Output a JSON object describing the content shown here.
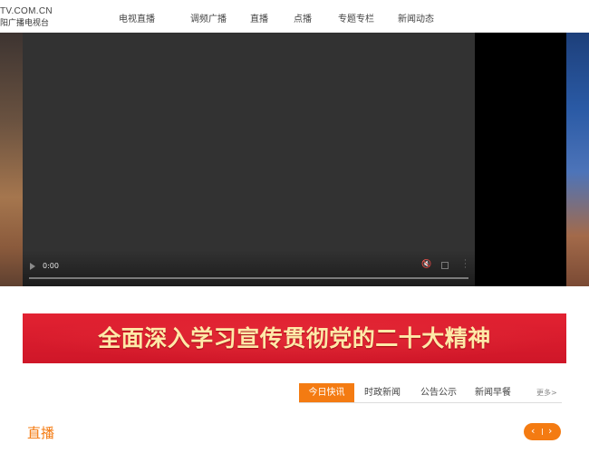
{
  "header": {
    "logo_top": "TV.COM.CN",
    "logo_bottom": "阳广播电视台",
    "nav": [
      "电视直播",
      "调频广播",
      "直播",
      "点播",
      "专题专栏",
      "新闻动态"
    ]
  },
  "video": {
    "time": "0:00",
    "progress": 0
  },
  "banner": {
    "text": "全面深入学习宣传贯彻党的二十大精神"
  },
  "tabs": {
    "items": [
      "今日快讯",
      "时政新闻",
      "公告公示",
      "新闻早餐"
    ],
    "active": 0,
    "more": "更多>"
  },
  "live": {
    "title": "直播"
  },
  "icons": {
    "play": "play-icon",
    "volume": "volume-mute-icon",
    "fullscreen": "fullscreen-icon",
    "more": "more-vertical-icon",
    "prev": "chevron-left-icon",
    "next": "chevron-right-icon"
  },
  "colors": {
    "accent": "#f47b12",
    "banner_red": "#d91a2b",
    "banner_text": "#ffe9a8"
  }
}
